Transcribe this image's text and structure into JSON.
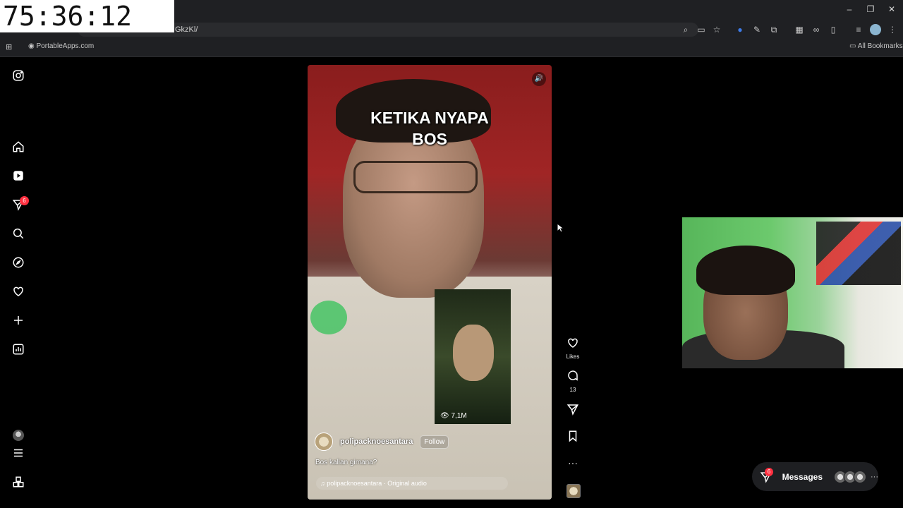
{
  "clock": {
    "time": "75:36:12"
  },
  "browser": {
    "url_fragment": "GkzKl/",
    "window_controls": {
      "minimize": "–",
      "restore": "❐",
      "close": "✕"
    },
    "bookmarks": {
      "portable_apps": "PortableApps.com",
      "all_bookmarks": "All Bookmarks"
    }
  },
  "sidebar": {
    "notifications_count": "6"
  },
  "reel": {
    "caption_line1": "KETIKA NYAPA",
    "caption_line2": "BOS",
    "username": "polipacknoesantara",
    "follow_label": "Follow",
    "description": "Bos kalian gimana?",
    "audio": "♫ polipacknoesantara · Original audio",
    "thumbnail_views": "👁 7,1M"
  },
  "actions": {
    "likes_label": "Likes",
    "comments_count": "13",
    "more_label": "···"
  },
  "messages": {
    "label": "Messages",
    "badge": "6",
    "more": "···"
  },
  "colors": {
    "badge_red": "#ff3040",
    "background": "#000000"
  }
}
